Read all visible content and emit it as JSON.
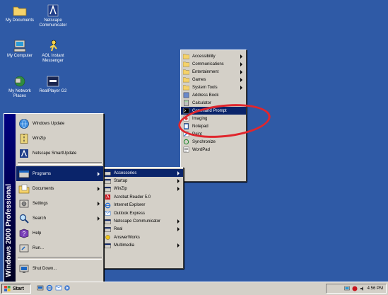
{
  "desktop": {
    "icons": [
      {
        "name": "my-documents",
        "label": "My Documents",
        "icon": "folder-icon"
      },
      {
        "name": "netscape-communicator",
        "label": "Netscape Communicator",
        "icon": "netscape-icon"
      },
      {
        "name": "my-computer",
        "label": "My Computer",
        "icon": "computer-icon"
      },
      {
        "name": "aol-instant-messenger",
        "label": "AOL Instant Messenger",
        "icon": "aim-icon"
      },
      {
        "name": "my-network-places",
        "label": "My Network Places",
        "icon": "network-icon"
      },
      {
        "name": "realplayer-g2",
        "label": "RealPlayer G2",
        "icon": "realplayer-icon"
      }
    ]
  },
  "start_menu": {
    "banner": "Windows 2000 Professional",
    "items": [
      {
        "label": "Windows Update",
        "icon": "globe-icon",
        "arrow": false
      },
      {
        "label": "WinZip",
        "icon": "winzip-icon",
        "arrow": false
      },
      {
        "label": "Netscape SmartUpdate",
        "icon": "netscape-icon",
        "arrow": false
      },
      {
        "label": "Programs",
        "icon": "programs-icon",
        "arrow": true,
        "highlighted": true
      },
      {
        "label": "Documents",
        "icon": "documents-icon",
        "arrow": true
      },
      {
        "label": "Settings",
        "icon": "settings-icon",
        "arrow": true
      },
      {
        "label": "Search",
        "icon": "search-icon",
        "arrow": true
      },
      {
        "label": "Help",
        "icon": "help-icon",
        "arrow": false
      },
      {
        "label": "Run...",
        "icon": "run-icon",
        "arrow": false
      },
      {
        "label": "Shut Down...",
        "icon": "shutdown-icon",
        "arrow": false
      }
    ]
  },
  "programs_menu": {
    "items": [
      {
        "label": "Accessories",
        "arrow": true,
        "highlighted": true
      },
      {
        "label": "Startup",
        "arrow": true
      },
      {
        "label": "WinZip",
        "arrow": true
      },
      {
        "label": "Acrobat Reader 5.0",
        "arrow": false
      },
      {
        "label": "Internet Explorer",
        "arrow": false
      },
      {
        "label": "Outlook Express",
        "arrow": false
      },
      {
        "label": "Netscape Communicator",
        "arrow": true
      },
      {
        "label": "Real",
        "arrow": true
      },
      {
        "label": "AnswerWorks",
        "arrow": false
      },
      {
        "label": "Multimedia",
        "arrow": true
      }
    ]
  },
  "accessories_menu": {
    "items": [
      {
        "label": "Accessibility",
        "arrow": true
      },
      {
        "label": "Communications",
        "arrow": true
      },
      {
        "label": "Entertainment",
        "arrow": true
      },
      {
        "label": "Games",
        "arrow": true
      },
      {
        "label": "System Tools",
        "arrow": true
      },
      {
        "label": "Address Book",
        "arrow": false
      },
      {
        "label": "Calculator",
        "arrow": false
      },
      {
        "label": "Command Prompt",
        "arrow": false,
        "highlighted": true
      },
      {
        "label": "Imaging",
        "arrow": false
      },
      {
        "label": "Notepad",
        "arrow": false
      },
      {
        "label": "Paint",
        "arrow": false
      },
      {
        "label": "Synchronize",
        "arrow": false
      },
      {
        "label": "WordPad",
        "arrow": false
      }
    ]
  },
  "taskbar": {
    "start_label": "Start",
    "clock": "4:56 PM"
  },
  "colors": {
    "desktop": "#2f5aa6",
    "menu_face": "#d4d0c8",
    "highlight": "#0a246a",
    "annotation": "#e0262d"
  }
}
